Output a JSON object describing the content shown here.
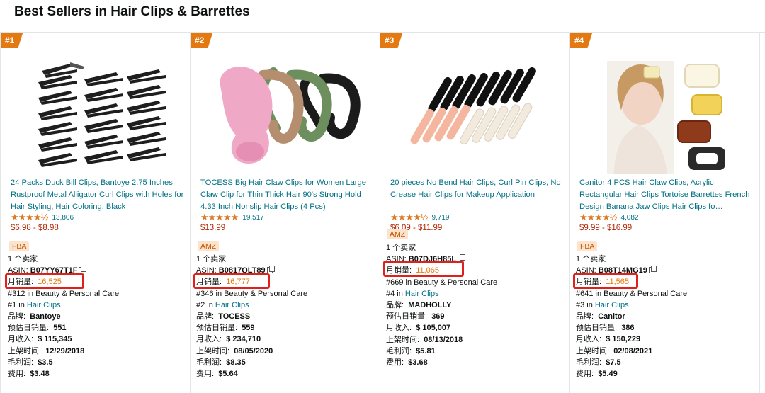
{
  "page": {
    "title": "Best Sellers in Hair Clips & Barrettes"
  },
  "products": [
    {
      "rank": "#1",
      "title": "24 Packs Duck Bill Clips, Bantoye 2.75 Inches Rustproof Metal Alligator Curl Clips with Holes for Hair Styling, Hair Coloring, Black",
      "stars": "★★★★½",
      "rating_count": "13,806",
      "price": "$6.98 - $8.98",
      "badge": "FBA",
      "sellers": "1 个卖家",
      "asin_label": "ASIN:",
      "asin": "B07YY67T1F",
      "monthly_sales_label": "月销量:",
      "monthly_sales": "16,525",
      "bsr_main": "#312 in Beauty & Personal Care",
      "bsr_sub_prefix": "#1 in",
      "bsr_sub_cat": "Hair Clips",
      "brand_label": "品牌:",
      "brand": "Bantoye",
      "daily_sales_label": "预估日销量:",
      "daily_sales": "551",
      "revenue_label": "月收入:",
      "revenue": "$ 115,345",
      "listed_label": "上架时间:",
      "listed": "12/29/2018",
      "margin_label": "毛利润:",
      "margin": "$3.5",
      "fee_label": "费用:",
      "fee": "$3.48"
    },
    {
      "rank": "#2",
      "title": "TOCESS Big Hair Claw Clips for Women Large Claw Clip for Thin Thick Hair 90's Strong Hold 4.33 Inch Nonslip Hair Clips (4 Pcs)",
      "stars": "★★★★★",
      "rating_count": "19,517",
      "price": "$13.99",
      "badge": "AMZ",
      "sellers": "1 个卖家",
      "asin_label": "ASIN:",
      "asin": "B0817QLT89",
      "monthly_sales_label": "月销量:",
      "monthly_sales": "16,777",
      "bsr_main": "#346 in Beauty & Personal Care",
      "bsr_sub_prefix": "#2 in",
      "bsr_sub_cat": "Hair Clips",
      "brand_label": "品牌:",
      "brand": "TOCESS",
      "daily_sales_label": "预估日销量:",
      "daily_sales": "559",
      "revenue_label": "月收入:",
      "revenue": "$ 234,710",
      "listed_label": "上架时间:",
      "listed": "08/05/2020",
      "margin_label": "毛利润:",
      "margin": "$8.35",
      "fee_label": "费用:",
      "fee": "$5.64"
    },
    {
      "rank": "#3",
      "title": "20 pieces No Bend Hair Clips, Curl Pin Clips, No Crease Hair Clips for Makeup Application",
      "stars": "★★★★½",
      "rating_count": "9,719",
      "price": "$6.09 - $11.99",
      "badge": "AMZ",
      "sellers": "1 个卖家",
      "asin_label": "ASIN:",
      "asin": "B07DJ6H85L",
      "monthly_sales_label": "月销量:",
      "monthly_sales": "11,065",
      "bsr_main": "#669 in Beauty & Personal Care",
      "bsr_sub_prefix": "#4 in",
      "bsr_sub_cat": "Hair Clips",
      "brand_label": "品牌:",
      "brand": "MADHOLLY",
      "daily_sales_label": "预估日销量:",
      "daily_sales": "369",
      "revenue_label": "月收入:",
      "revenue": "$ 105,007",
      "listed_label": "上架时间:",
      "listed": "08/13/2018",
      "margin_label": "毛利润:",
      "margin": "$5.81",
      "fee_label": "费用:",
      "fee": "$3.68"
    },
    {
      "rank": "#4",
      "title": "Canitor 4 PCS Hair Claw Clips, Acrylic Rectangular Hair Clips Tortoise Barrettes French Design Banana Jaw Clips Hair Clips fo…",
      "stars": "★★★★½",
      "rating_count": "4,082",
      "price": "$9.99 - $16.99",
      "badge": "FBA",
      "sellers": "1 个卖家",
      "asin_label": "ASIN:",
      "asin": "B08T14MG19",
      "monthly_sales_label": "月销量:",
      "monthly_sales": "11,565",
      "bsr_main": "#641 in Beauty & Personal Care",
      "bsr_sub_prefix": "#3 in",
      "bsr_sub_cat": "Hair Clips",
      "brand_label": "品牌:",
      "brand": "Canitor",
      "daily_sales_label": "预估日销量:",
      "daily_sales": "386",
      "revenue_label": "月收入:",
      "revenue": "$ 150,229",
      "listed_label": "上架时间:",
      "listed": "02/08/2021",
      "margin_label": "毛利润:",
      "margin": "$7.5",
      "fee_label": "费用:",
      "fee": "$5.49"
    }
  ],
  "colors": {
    "link": "#007185",
    "price": "#b12704",
    "rank_badge": "#e47911",
    "highlight": "#e0201b"
  }
}
